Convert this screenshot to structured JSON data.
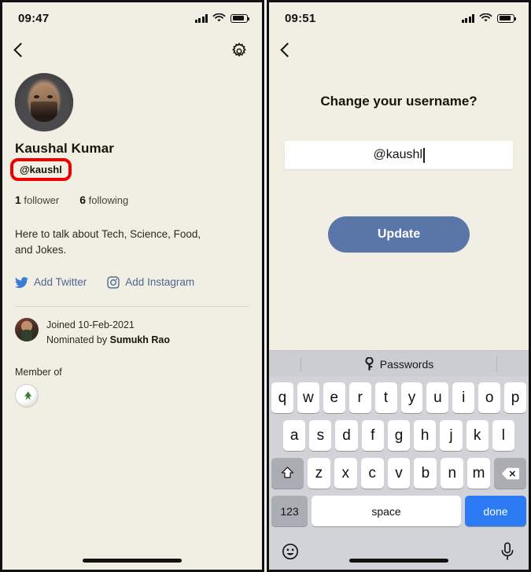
{
  "colors": {
    "app_background": "#F1EFE3",
    "accent_blue": "#5A76A8",
    "link_blue": "#4E6593",
    "annotation_red": "#EE0000",
    "keyboard_background": "#D1D3D9",
    "done_key_blue": "#2C7BF5"
  },
  "left_phone": {
    "status": {
      "time": "09:47",
      "signal_icon": "signal-bars-icon",
      "wifi_icon": "wifi-icon",
      "battery_icon": "battery-icon"
    },
    "nav": {
      "back_icon": "chevron-left-icon",
      "settings_icon": "gear-icon"
    },
    "profile": {
      "avatar_icon": "user-avatar",
      "name": "Kaushal Kumar",
      "handle": "@kaushl",
      "handle_highlighted": true,
      "followers_count": "1",
      "followers_label": "follower",
      "following_count": "6",
      "following_label": "following",
      "bio": "Here to talk about Tech, Science, Food, and Jokes."
    },
    "socials": [
      {
        "icon": "twitter-icon",
        "label": "Add Twitter"
      },
      {
        "icon": "instagram-icon",
        "label": "Add Instagram"
      }
    ],
    "joined": {
      "nominator_avatar_icon": "nominator-avatar",
      "joined_text": "Joined 10-Feb-2021",
      "nominated_prefix": "Nominated by ",
      "nominated_by": "Sumukh Rao"
    },
    "member_of": {
      "label": "Member of",
      "club_icon": "club-avatar"
    }
  },
  "right_phone": {
    "status": {
      "time": "09:51",
      "signal_icon": "signal-bars-icon",
      "wifi_icon": "wifi-icon",
      "battery_icon": "battery-icon"
    },
    "nav": {
      "back_icon": "chevron-left-icon"
    },
    "title": "Change your username?",
    "username_field": {
      "value": "@kaushl",
      "placeholder": "@username"
    },
    "update_button": "Update",
    "keyboard": {
      "toolbar": {
        "icon": "key-icon",
        "label": "Passwords"
      },
      "row1": [
        "q",
        "w",
        "e",
        "r",
        "t",
        "y",
        "u",
        "i",
        "o",
        "p"
      ],
      "row2": [
        "a",
        "s",
        "d",
        "f",
        "g",
        "h",
        "j",
        "k",
        "l"
      ],
      "row3": [
        "z",
        "x",
        "c",
        "v",
        "b",
        "n",
        "m"
      ],
      "shift_icon": "shift-icon",
      "backspace_icon": "backspace-icon",
      "numbers_key": "123",
      "space_key": "space",
      "done_key": "done",
      "emoji_icon": "emoji-icon",
      "mic_icon": "microphone-icon"
    }
  }
}
